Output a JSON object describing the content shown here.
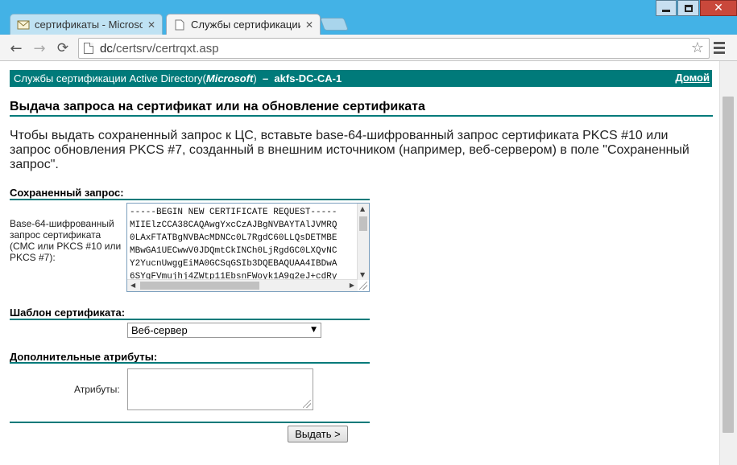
{
  "window": {
    "close_glyph": "✕"
  },
  "tabs": [
    {
      "title": "сертификаты - Microsoft",
      "close": "✕"
    },
    {
      "title": "Службы сертификации Ac",
      "close": "✕"
    }
  ],
  "toolbar": {
    "back": "←",
    "forward": "→",
    "reload": "⟳",
    "url_host": "dc",
    "url_path": "/certsrv/certrqxt.asp",
    "star": "☆"
  },
  "header": {
    "service": "Службы сертификации",
    "product": "Active Directory",
    "vendor_open": " (",
    "vendor": "Microsoft",
    "vendor_close": ")",
    "sep": "  –  ",
    "ca_name": "akfs-DC-CA-1",
    "home_link": "Домой"
  },
  "page": {
    "title": "Выдача запроса на сертификат или на обновление сертификата",
    "intro": "Чтобы выдать сохраненный запрос к ЦС, вставьте base-64-шифрованный запрос сертификата PKCS #10 или запрос обновления PKCS #7, созданный в внешним источником (например, веб-сервером) в поле \"Сохраненный запрос\"."
  },
  "saved_request": {
    "section_label": "Сохраненный запрос:",
    "caption": "Base-64-шифрованный запрос сертификата (CMC или PKCS #10 или PKCS #7):",
    "value": "-----BEGIN NEW CERTIFICATE REQUEST-----\nMIIElzCCA38CAQAwgYxcCzAJBgNVBAYTAlJVMRQ\n0LAxFTATBgNVBAcMDNCc0L7RgdC60LLQsDETMBE\nMBwGA1UECwwV0JDQmtCkINCh0LjRgdGC0LXQvNC\nY2YucnUwggEiMA0GCSqGSIb3DQEBAQUAA4IBDwA\n6SYqFVmujhj4ZWtp11EbsnFWoyk1A9g2eJ+cdRy"
  },
  "template": {
    "section_label": "Шаблон сертификата:",
    "selected": "Веб-сервер",
    "caret": "▼"
  },
  "attributes": {
    "section_label": "Дополнительные атрибуты:",
    "caption": "Атрибуты:",
    "value": ""
  },
  "actions": {
    "submit": "Выдать >"
  },
  "colors": {
    "header_band": "#007a7a",
    "titlebar": "#43b2e6"
  }
}
